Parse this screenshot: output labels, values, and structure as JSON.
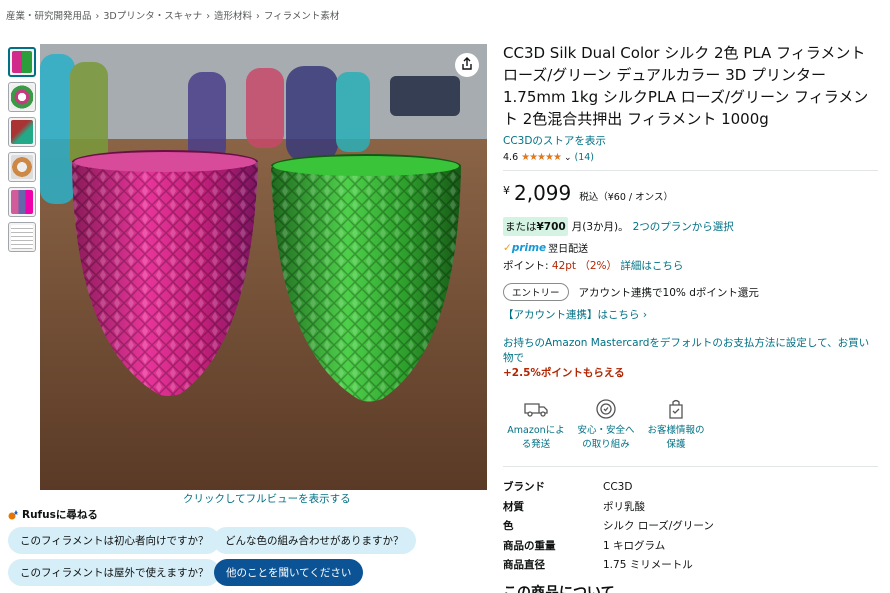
{
  "breadcrumb": [
    "産業・研究開発用品",
    "3Dプリンタ・スキャナ",
    "造形材料",
    "フィラメント素材"
  ],
  "breadcrumb_sep": "›",
  "image": {
    "fullview_link": "クリックしてフルビューを表示する"
  },
  "rufus": {
    "title": "Rufusに尋ねる",
    "chips": [
      "このフィラメントは初心者向けですか？",
      "どんな色の組み合わせがありますか？",
      "このフィラメントは屋外で使えますか？",
      "他のことを聞いてください"
    ]
  },
  "product": {
    "title": "CC3D Silk Dual Color シルク 2色 PLA フィラメント ローズ/グリーン デュアルカラー 3D プリンター 1.75mm 1kg シルクPLA ローズ/グリーン フィラメント 2色混合共押出 フィラメント 1000g",
    "store_link": "CC3Dのストアを表示",
    "rating_value": "4.6",
    "stars": "★★★★★",
    "rating_count": "(14)",
    "price_symbol": "¥",
    "price": "2,099",
    "price_unit": "税込（¥60 / オンス）",
    "installment_prefix": "または",
    "installment_amount": "¥700",
    "installment_suffix": "月(3か月)。",
    "installment_link": "2つのプランから選択",
    "prime_label": "prime",
    "delivery": "翌日配送",
    "points_label": "ポイント:",
    "points_value": "42pt （2%）",
    "points_link": "詳細はこちら",
    "entry_badge": "エントリー",
    "entry_text": "アカウント連携で10% dポイント還元",
    "account_link": "【アカウント連携】はこちら ›",
    "card_text": "お持ちのAmazon Mastercardをデフォルトのお支払方法に設定して、お買い物で",
    "card_bonus": "+2.5%ポイントもらえる"
  },
  "features": [
    {
      "label": "Amazonによる発送",
      "icon": "truck-icon"
    },
    {
      "label": "安心・安全への取り組み",
      "icon": "shield-icon"
    },
    {
      "label": "お客様情報の保護",
      "icon": "lock-bag-icon"
    }
  ],
  "specs": [
    {
      "key": "ブランド",
      "value": "CC3D"
    },
    {
      "key": "材質",
      "value": "ポリ乳酸"
    },
    {
      "key": "色",
      "value": "シルク ローズ/グリーン"
    },
    {
      "key": "商品の重量",
      "value": "1 キログラム"
    },
    {
      "key": "商品直径",
      "value": "1.75 ミリメートル"
    }
  ],
  "about_heading": "この商品について",
  "colors": {
    "link": "#007185",
    "price_red": "#b12704",
    "prime_blue": "#1399d6",
    "chip_bg": "#d6eef7",
    "chip_dark": "#0b5394"
  }
}
